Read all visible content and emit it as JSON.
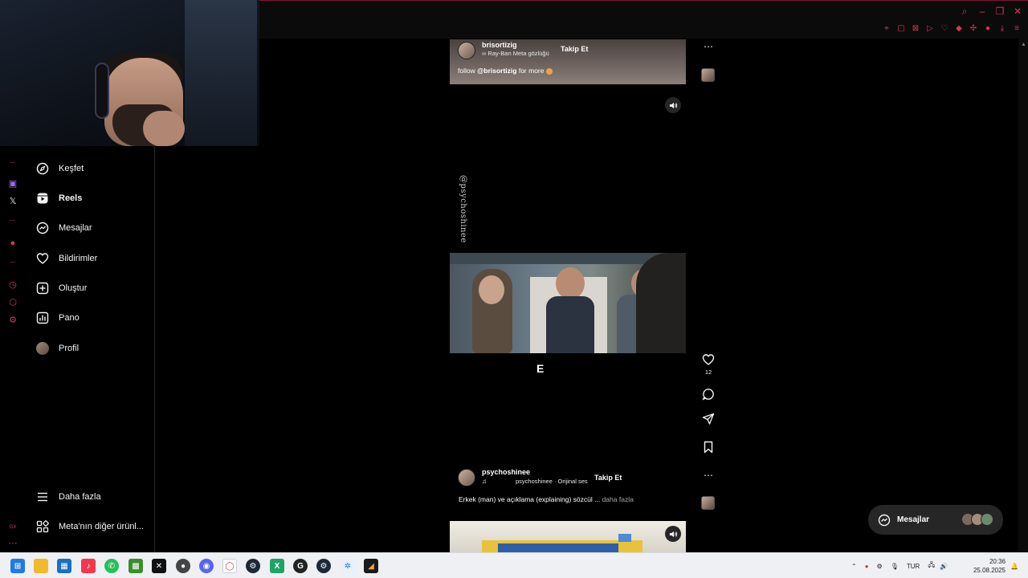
{
  "sidebar": {
    "items": [
      {
        "label": "Keşfet",
        "icon": "compass-icon"
      },
      {
        "label": "Reels",
        "icon": "reels-icon"
      },
      {
        "label": "Mesajlar",
        "icon": "messenger-icon"
      },
      {
        "label": "Bildirimler",
        "icon": "heart-icon"
      },
      {
        "label": "Oluştur",
        "icon": "plus-square-icon"
      },
      {
        "label": "Pano",
        "icon": "dashboard-icon"
      },
      {
        "label": "Profil",
        "icon": "avatar"
      }
    ],
    "more_label": "Daha fazla",
    "meta_label": "Meta'nın diğer ürünl..."
  },
  "reel1": {
    "username": "brisortizig",
    "subline": "∞ Ray-Ban Meta gözlüğü",
    "follow": "Takip Et",
    "caption_prefix": "follow ",
    "caption_handle": "@brisortizig",
    "caption_suffix": " for more"
  },
  "reel2": {
    "watermark": "@psychoshinee",
    "subtitle_text": "E",
    "like_count": "12"
  },
  "reel3": {
    "username": "psychoshinee",
    "audio": "psychoshinee · Orijinal ses",
    "follow": "Takip Et",
    "caption": "Erkek (man) ve açıklama (explaining) sözcül ...",
    "more": "daha fazla"
  },
  "messages_pill": {
    "label": "Mesajlar"
  },
  "taskbar": {
    "lang": "TUR",
    "time": "20:36",
    "date": "25.08.2025"
  },
  "colors": {
    "accent": "#e0335a",
    "background": "#000000",
    "surface": "#262626"
  }
}
